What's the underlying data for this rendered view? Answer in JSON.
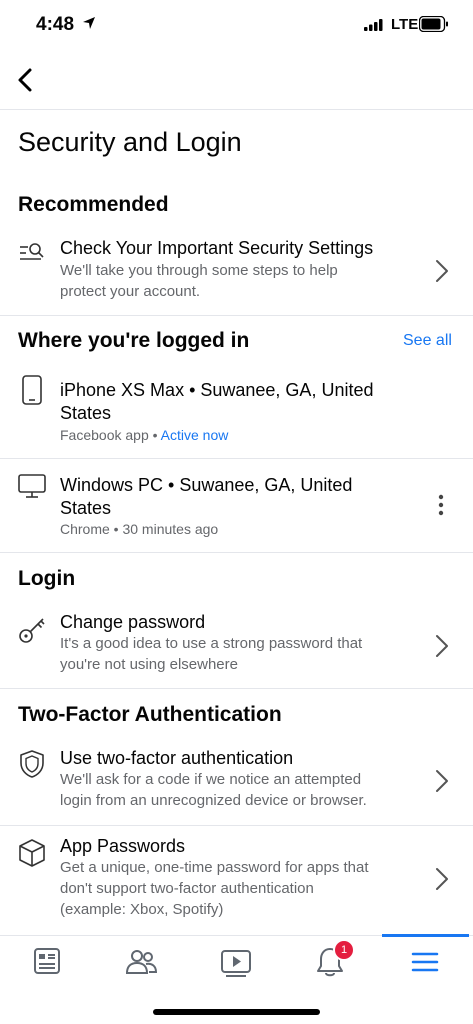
{
  "status_bar": {
    "time": "4:48",
    "network": "LTE"
  },
  "header": {
    "title": "Security and Login"
  },
  "recommended": {
    "heading": "Recommended",
    "item": {
      "title": "Check Your Important Security Settings",
      "line1": "We'll take you through some steps to help",
      "line2": "protect your account."
    }
  },
  "logged_in": {
    "heading": "Where you're logged in",
    "see_all": "See all",
    "devices": [
      {
        "line1": "iPhone XS Max • Suwanee, GA, United",
        "line2": "States",
        "app": "Facebook app • ",
        "status": "Active now"
      },
      {
        "line1": "Windows PC • Suwanee, GA, United",
        "line2": "States",
        "app": "Chrome • 30 minutes ago"
      }
    ]
  },
  "login": {
    "heading": "Login",
    "item": {
      "title": "Change password",
      "line1": "It's a good idea to use a strong password that",
      "line2": "you're not using elsewhere"
    }
  },
  "two_factor": {
    "heading": "Two-Factor Authentication",
    "items": [
      {
        "title": "Use two-factor authentication",
        "line1": "We'll ask for a code if we notice an attempted",
        "line2": "login from an unrecognized device or browser."
      },
      {
        "title": "App Passwords",
        "line1": "Get a unique, one-time password for apps that",
        "line2": "don't support two-factor authentication",
        "line3": "(example: Xbox, Spotify)"
      }
    ]
  },
  "tabbar": {
    "notifications_badge": "1"
  },
  "colors": {
    "accent": "#1877f2",
    "badge": "#e41e3f"
  }
}
